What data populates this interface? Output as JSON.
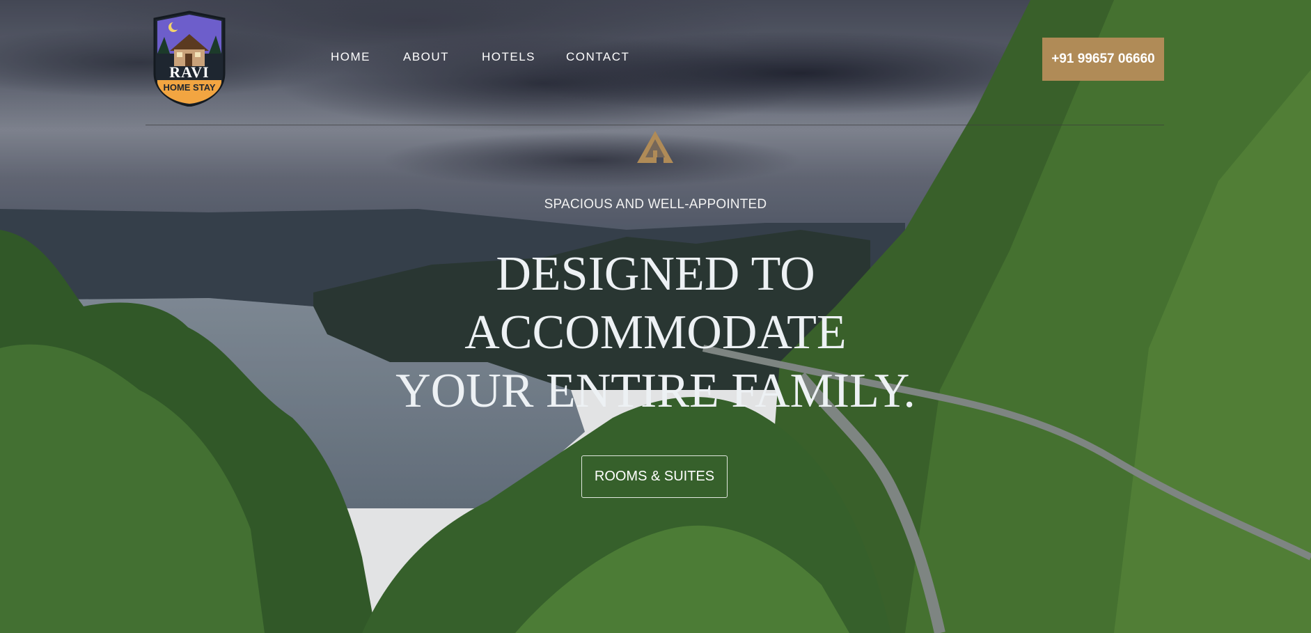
{
  "brand": {
    "logo_line1": "RAVI",
    "logo_line2": "HOME STAY",
    "accent_color": "#b08b57"
  },
  "nav": {
    "items": [
      {
        "label": "HOME"
      },
      {
        "label": "ABOUT"
      },
      {
        "label": "HOTELS"
      },
      {
        "label": "CONTACT"
      }
    ]
  },
  "header": {
    "phone": "+91 99657 06660"
  },
  "hero": {
    "subtitle": "SPACIOUS AND WELL-APPOINTED",
    "headline_lines": [
      "DESIGNED TO",
      "ACCOMMODATE",
      "YOUR ENTIRE FAMILY."
    ],
    "cta_label": "ROOMS & SUITES",
    "icon": "home-icon"
  }
}
